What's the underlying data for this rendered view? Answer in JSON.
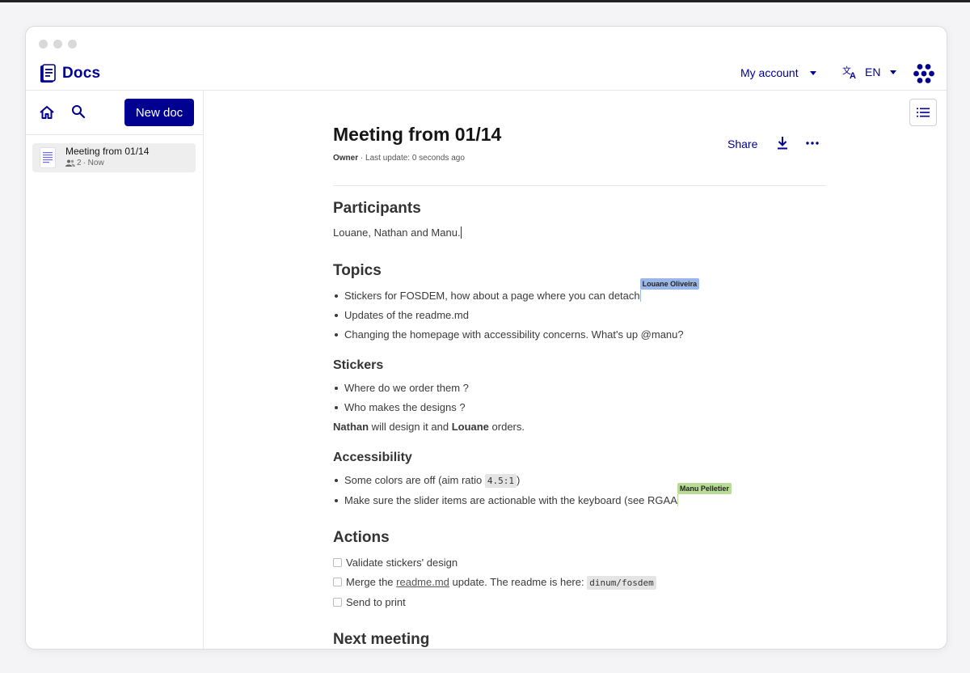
{
  "app": {
    "name": "Docs",
    "brand_color": "#000091"
  },
  "header": {
    "account_label": "My account",
    "language_label": "EN",
    "language_icon": "translate-icon",
    "apps_icon": "apps-grid-icon"
  },
  "sidebar": {
    "new_doc_label": "New doc",
    "home_icon": "home-icon",
    "search_icon": "search-icon",
    "documents": [
      {
        "title": "Meeting from 01/14",
        "participants": "2",
        "time": "· Now"
      }
    ]
  },
  "document": {
    "title": "Meeting from 01/14",
    "role": "Owner",
    "last_update": "· Last update: 0 seconds ago",
    "share_label": "Share",
    "actions_icons": [
      "download-icon",
      "more-icon",
      "table-of-contents-icon"
    ],
    "sections": {
      "participants_heading": "Participants",
      "participants_text": "Louane, Nathan and Manu.",
      "topics_heading": "Topics",
      "topics": [
        "Stickers for FOSDEM, how about a page where you can detach",
        "Updates of the readme.md",
        "Changing the homepage with accessibility concerns. What's up @manu?"
      ],
      "stickers_heading": "Stickers",
      "stickers": [
        "Where do we order them ?",
        "Who makes the designs ?"
      ],
      "stickers_note": {
        "name1": "Nathan",
        "mid": " will design it and ",
        "name2": "Louane",
        "end": " orders."
      },
      "accessibility_heading": "Accessibility",
      "accessibility": {
        "item1_prefix": "Some colors are off (aim ratio ",
        "item1_code": "4.5:1",
        "item1_suffix": ")",
        "item2": "Make sure the slider items are actionable with the keyboard (see RGAA"
      },
      "actions_heading": "Actions",
      "actions": {
        "item1": "Validate stickers' design",
        "item2_prefix": "Merge the ",
        "item2_link": "readme.md",
        "item2_mid": " update. The readme is here: ",
        "item2_code": "dinum/fosdem",
        "item3": "Send to print"
      },
      "next_heading": "Next meeting"
    },
    "collaborators": [
      {
        "name": "Louane Oliveira",
        "color": "#9bb7e8"
      },
      {
        "name": "Manu Pelletier",
        "color": "#b8dc96"
      }
    ]
  }
}
